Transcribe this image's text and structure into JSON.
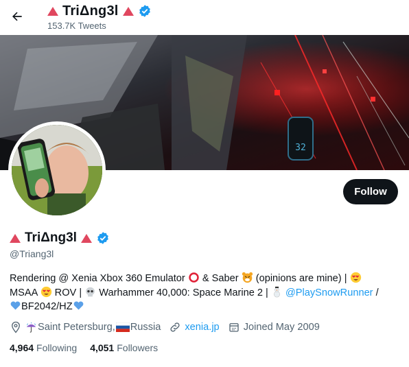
{
  "header": {
    "title": "TriΔng3l",
    "tweets": "153.7K Tweets"
  },
  "profile": {
    "name": "TriΔng3l",
    "handle": "@Triang3l",
    "follow_label": "Follow",
    "bio": {
      "p1": "Rendering @ Xenia Xbox 360 Emulator ",
      "p2": " & Saber ",
      "p3": " (opinions are mine) | ",
      "p4": "MSAA ",
      "p5": " ROV | ",
      "p6": " Warhammer 40,000: Space Marine 2 | ",
      "mention": "@PlaySnowRunner",
      "p7": " /",
      "p8": "BF2042/HZ"
    },
    "location_a": "Saint Petersburg, ",
    "location_b": "Russia",
    "website": "xenia.jp",
    "joined": "Joined May 2009",
    "following_count": "4,964",
    "following_label": "Following",
    "followers_count": "4,051",
    "followers_label": "Followers"
  },
  "colors": {
    "accent": "#1d9bf0",
    "triangle": "#e0475f",
    "text": "#0f1419",
    "muted": "#536471"
  },
  "icons": [
    "back-arrow-icon",
    "triangle-icon",
    "verified-badge-icon",
    "location-pin-icon",
    "link-icon",
    "calendar-icon",
    "umbrella-emoji",
    "russia-flag-emoji",
    "heart-eyes-emoji",
    "tiger-emoji",
    "skull-emoji",
    "snowman-emoji",
    "blue-heart-emoji",
    "red-circle-emoji"
  ]
}
